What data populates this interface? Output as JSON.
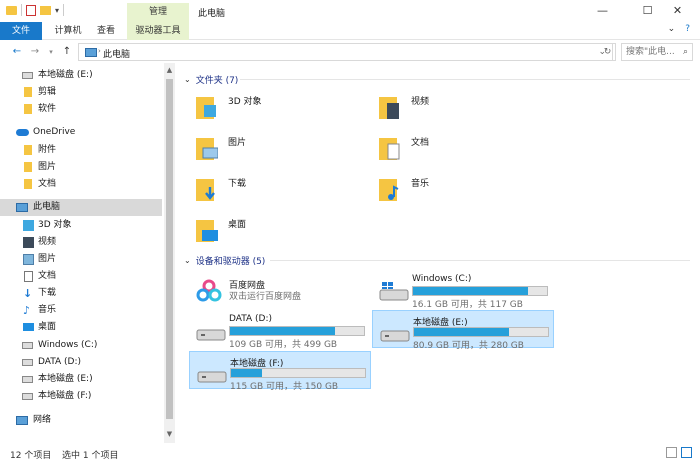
{
  "titlebar": {
    "manage_tab": "管理",
    "window_title": "此电脑",
    "minimize": "—",
    "maximize": "☐",
    "close": "✕"
  },
  "ribbon": {
    "tabs": [
      "文件",
      "计算机",
      "查看",
      "驱动器工具"
    ],
    "file_tab_color": "#1979ca",
    "context_tab_color": "#e8f3cf"
  },
  "address": {
    "path": "此电脑",
    "search_placeholder": "搜索\"此电..."
  },
  "sidebar": {
    "items": [
      {
        "label": "本地磁盘 (E:)",
        "icon": "drive-icon"
      },
      {
        "label": "剪辑",
        "icon": "folder-icon"
      },
      {
        "label": "软件",
        "icon": "folder-icon"
      },
      {
        "label": "OneDrive",
        "icon": "cloud-icon"
      },
      {
        "label": "附件",
        "icon": "folder-icon"
      },
      {
        "label": "图片",
        "icon": "folder-icon"
      },
      {
        "label": "文档",
        "icon": "folder-icon"
      },
      {
        "label": "此电脑",
        "icon": "computer-icon"
      },
      {
        "label": "3D 对象",
        "icon": "3d-objects-icon"
      },
      {
        "label": "视频",
        "icon": "video-icon"
      },
      {
        "label": "图片",
        "icon": "pictures-icon"
      },
      {
        "label": "文档",
        "icon": "documents-icon"
      },
      {
        "label": "下载",
        "icon": "download-icon"
      },
      {
        "label": "音乐",
        "icon": "music-icon"
      },
      {
        "label": "桌面",
        "icon": "desktop-icon"
      },
      {
        "label": "Windows (C:)",
        "icon": "windows-drive-icon"
      },
      {
        "label": "DATA (D:)",
        "icon": "drive-icon"
      },
      {
        "label": "本地磁盘 (E:)",
        "icon": "drive-icon"
      },
      {
        "label": "本地磁盘 (F:)",
        "icon": "drive-icon"
      },
      {
        "label": "网络",
        "icon": "network-icon"
      }
    ]
  },
  "main": {
    "folders_header": "文件夹 (7)",
    "folders": [
      {
        "label": "3D 对象",
        "icon": "3d-objects-icon"
      },
      {
        "label": "视频",
        "icon": "video-icon"
      },
      {
        "label": "图片",
        "icon": "pictures-icon"
      },
      {
        "label": "文档",
        "icon": "documents-icon"
      },
      {
        "label": "下载",
        "icon": "download-icon"
      },
      {
        "label": "音乐",
        "icon": "music-icon"
      },
      {
        "label": "桌面",
        "icon": "desktop-icon"
      }
    ],
    "devices_header": "设备和驱动器 (5)",
    "baidu": {
      "name": "百度网盘",
      "subtitle": "双击运行百度网盘"
    },
    "drives": [
      {
        "name": "Windows (C:)",
        "info": "16.1 GB 可用，共 117 GB",
        "used_fraction": 0.86
      },
      {
        "name": "DATA (D:)",
        "info": "109 GB 可用，共 499 GB",
        "used_fraction": 0.78
      },
      {
        "name": "本地磁盘 (E:)",
        "info": "80.9 GB 可用，共 280 GB",
        "used_fraction": 0.71
      },
      {
        "name": "本地磁盘 (F:)",
        "info": "115 GB 可用，共 150 GB",
        "used_fraction": 0.23
      }
    ]
  },
  "status": {
    "count": "12 个项目",
    "selection": "选中 1 个项目"
  }
}
